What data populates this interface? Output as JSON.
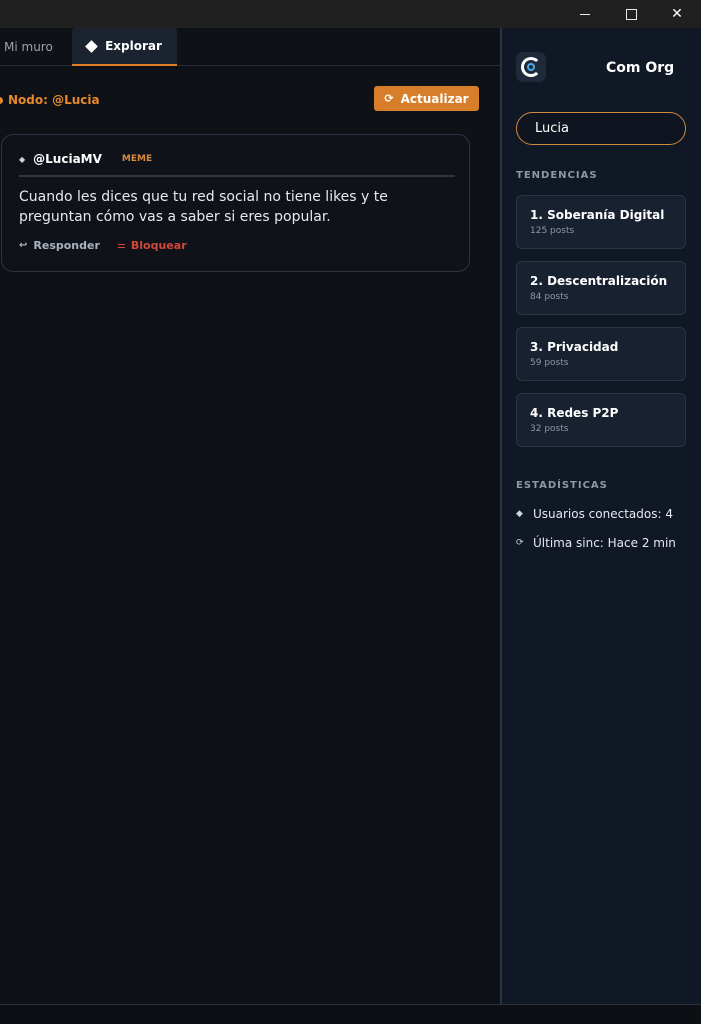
{
  "window": {
    "minimize_label": "",
    "close_glyph": "✕"
  },
  "tabs": [
    {
      "label": "Mi muro"
    },
    {
      "label": "Explorar"
    }
  ],
  "node": {
    "label": "Nodo: @Lucia"
  },
  "refresh": {
    "icon": "⟳",
    "label": "Actualizar"
  },
  "post": {
    "user_icon": "◆",
    "handle": "@LuciaMV",
    "tag": "MEME",
    "text": "Cuando les dices que tu red social no tiene likes y te preguntan cómo vas a saber si eres popular.",
    "reply_icon": "↩",
    "reply_label": "Responder",
    "block_label": "Bloquear"
  },
  "sidebar": {
    "app_name": "Com Org",
    "search_value": "Lucia",
    "trends_title": "TENDENCIAS",
    "trends": [
      {
        "title": "1. Soberanía Digital",
        "count": "125 posts"
      },
      {
        "title": "2. Descentralización",
        "count": "84 posts"
      },
      {
        "title": "3. Privacidad",
        "count": "59 posts"
      },
      {
        "title": "4. Redes P2P",
        "count": "32 posts"
      }
    ],
    "stats_title": "ESTADÍSTICAS",
    "stats": [
      {
        "icon": "◆",
        "text": "Usuarios conectados: 4"
      },
      {
        "icon": "⟳",
        "text": "Última sinc: Hace 2 min"
      }
    ]
  },
  "colors": {
    "accent": "#d77e2b",
    "danger": "#d2473a",
    "logo_ring": "#4fa8e8"
  }
}
